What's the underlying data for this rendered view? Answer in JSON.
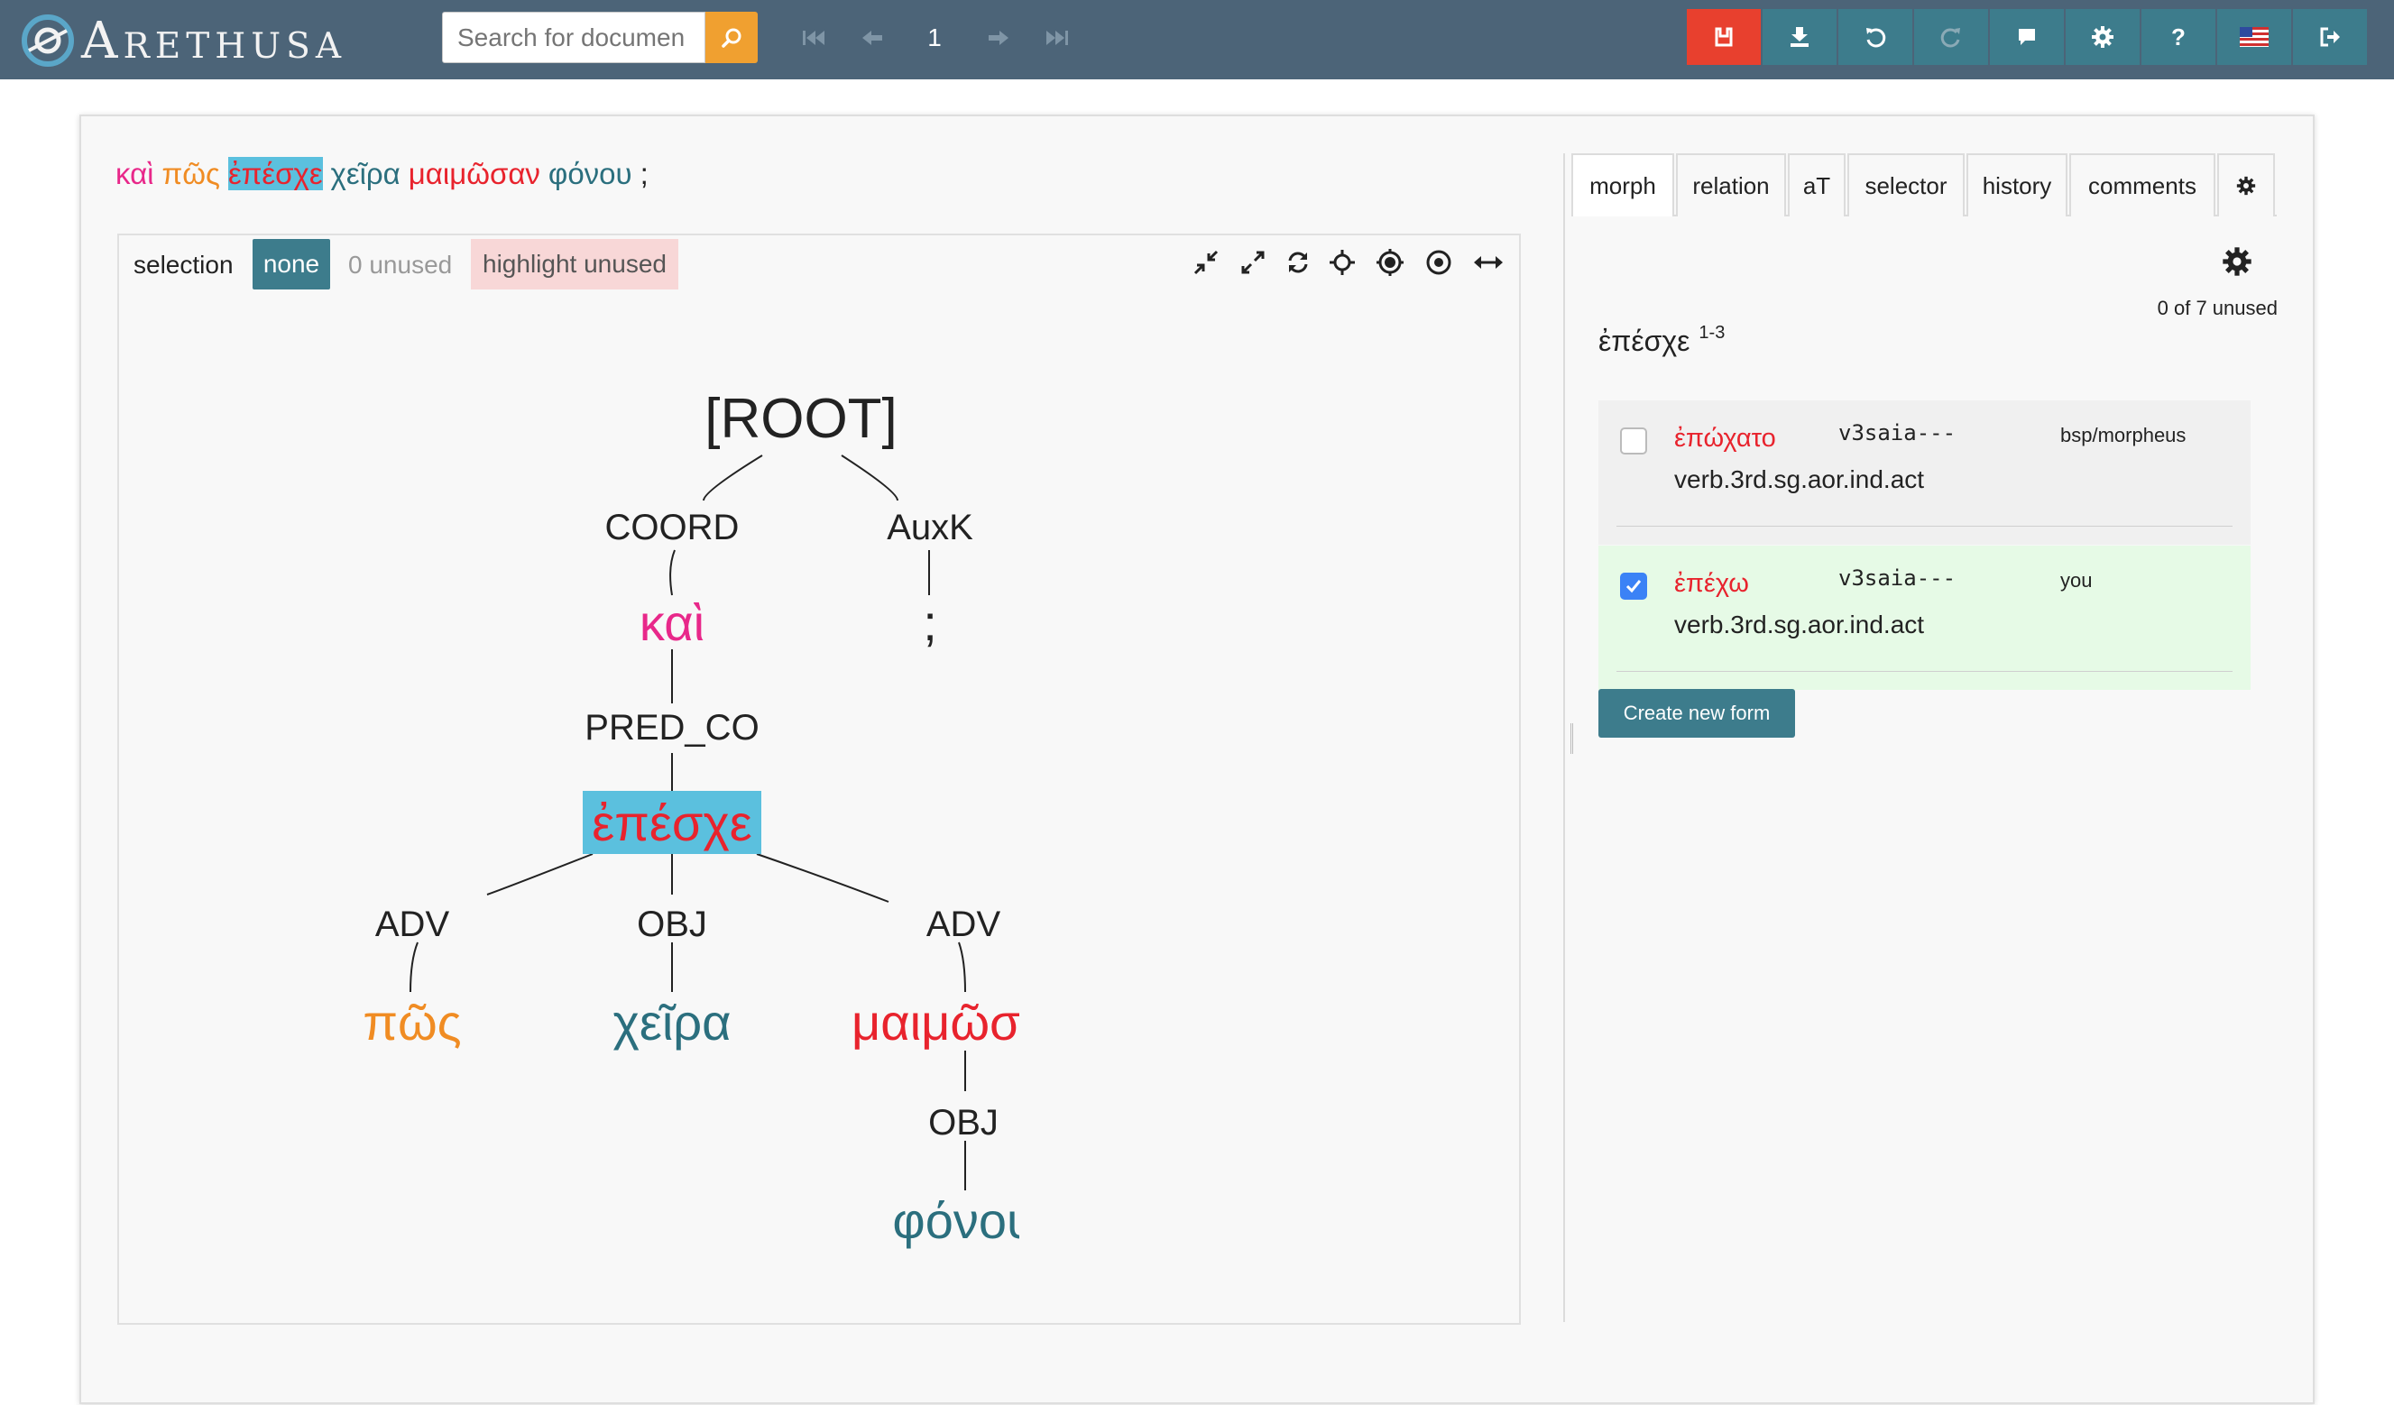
{
  "app": {
    "logo_text": "Arethusa"
  },
  "nav": {
    "search_placeholder": "Search for documen",
    "page_number": "1",
    "icons": [
      "search-icon",
      "first-page-icon",
      "prev-page-icon",
      "next-page-icon",
      "last-page-icon",
      "save-icon",
      "download-icon",
      "undo-icon",
      "redo-icon",
      "comment-icon",
      "gear-icon",
      "help-icon",
      "us-flag-icon",
      "logout-icon"
    ],
    "colors": {
      "bar": "#4c6478",
      "tool": "#3d7c8c",
      "save": "#e8402e",
      "search": "#f0a030"
    }
  },
  "sentence": [
    {
      "text": "καὶ",
      "color": "#e8288a"
    },
    {
      "text": "πῶς",
      "color": "#f08c23"
    },
    {
      "text": "ἐπέσχε",
      "color": "#e8232d",
      "selected": true
    },
    {
      "text": "χεῖρα",
      "color": "#2b6f7e"
    },
    {
      "text": "μαιμῶσαν",
      "color": "#e8232d"
    },
    {
      "text": "φόνου",
      "color": "#2b6f7e"
    },
    {
      "text": ";",
      "color": "#222222"
    }
  ],
  "tree_toolbar": {
    "selection_label": "selection",
    "none_label": "none",
    "unused_label": "0 unused",
    "highlight_label": "highlight unused",
    "tools": [
      "compress-icon",
      "expand-icon",
      "refresh-icon",
      "move-icon",
      "focus-icon",
      "center-icon",
      "width-icon"
    ]
  },
  "tree": {
    "root": "[ROOT]",
    "labels": {
      "coord": "COORD",
      "auxk": "AuxK",
      "pred_co": "PRED_CO",
      "adv1": "ADV",
      "obj1": "OBJ",
      "adv2": "ADV",
      "obj2": "OBJ"
    },
    "words": {
      "kai": "καὶ",
      "semicolon": ";",
      "epesche": "ἐπέσχε",
      "pos": "πῶς",
      "cheira": "χεῖρα",
      "maimosan": "μαιμῶσαν",
      "phonou": "φόνου"
    }
  },
  "right_panel": {
    "tabs": [
      "morph",
      "relation",
      "aT",
      "selector",
      "history",
      "comments"
    ],
    "settings_icon": "gear-icon",
    "unused_count": "0 of 7 unused",
    "form": {
      "word": "ἐπέσχε",
      "position": "1-3"
    },
    "analyses": [
      {
        "lemma": "ἐπώχατο",
        "postag": "v3saia---",
        "source": "bsp/morpheus",
        "desc": "verb.3rd.sg.aor.ind.act",
        "checked": false
      },
      {
        "lemma": "ἐπέχω",
        "postag": "v3saia---",
        "source": "you",
        "desc": "verb.3rd.sg.aor.ind.act",
        "checked": true
      }
    ],
    "create_button": "Create new form"
  }
}
